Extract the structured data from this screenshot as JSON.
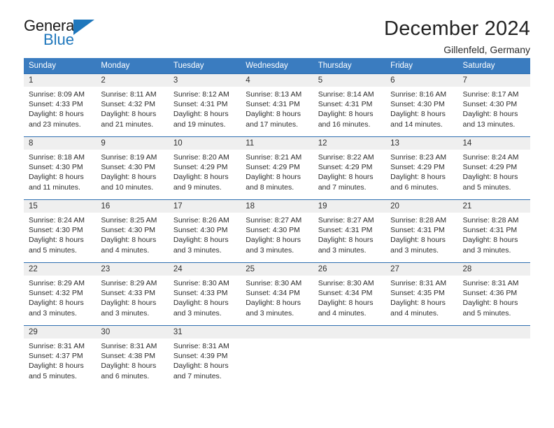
{
  "logo": {
    "name": "general-blue-logo",
    "text_top": "General",
    "text_bottom": "Blue",
    "accent_color": "#1f77bc"
  },
  "header": {
    "title": "December 2024",
    "location": "Gillenfeld, Germany"
  },
  "theme": {
    "header_row_bg": "#3a7cc0",
    "daynum_bg": "#efefef",
    "row_divider": "#2f6fb0",
    "text_color": "#2c2c2c"
  },
  "weekday_headers": [
    "Sunday",
    "Monday",
    "Tuesday",
    "Wednesday",
    "Thursday",
    "Friday",
    "Saturday"
  ],
  "weeks": [
    [
      {
        "day": "1",
        "sunrise": "Sunrise: 8:09 AM",
        "sunset": "Sunset: 4:33 PM",
        "daylight_line1": "Daylight: 8 hours",
        "daylight_line2": "and 23 minutes."
      },
      {
        "day": "2",
        "sunrise": "Sunrise: 8:11 AM",
        "sunset": "Sunset: 4:32 PM",
        "daylight_line1": "Daylight: 8 hours",
        "daylight_line2": "and 21 minutes."
      },
      {
        "day": "3",
        "sunrise": "Sunrise: 8:12 AM",
        "sunset": "Sunset: 4:31 PM",
        "daylight_line1": "Daylight: 8 hours",
        "daylight_line2": "and 19 minutes."
      },
      {
        "day": "4",
        "sunrise": "Sunrise: 8:13 AM",
        "sunset": "Sunset: 4:31 PM",
        "daylight_line1": "Daylight: 8 hours",
        "daylight_line2": "and 17 minutes."
      },
      {
        "day": "5",
        "sunrise": "Sunrise: 8:14 AM",
        "sunset": "Sunset: 4:31 PM",
        "daylight_line1": "Daylight: 8 hours",
        "daylight_line2": "and 16 minutes."
      },
      {
        "day": "6",
        "sunrise": "Sunrise: 8:16 AM",
        "sunset": "Sunset: 4:30 PM",
        "daylight_line1": "Daylight: 8 hours",
        "daylight_line2": "and 14 minutes."
      },
      {
        "day": "7",
        "sunrise": "Sunrise: 8:17 AM",
        "sunset": "Sunset: 4:30 PM",
        "daylight_line1": "Daylight: 8 hours",
        "daylight_line2": "and 13 minutes."
      }
    ],
    [
      {
        "day": "8",
        "sunrise": "Sunrise: 8:18 AM",
        "sunset": "Sunset: 4:30 PM",
        "daylight_line1": "Daylight: 8 hours",
        "daylight_line2": "and 11 minutes."
      },
      {
        "day": "9",
        "sunrise": "Sunrise: 8:19 AM",
        "sunset": "Sunset: 4:30 PM",
        "daylight_line1": "Daylight: 8 hours",
        "daylight_line2": "and 10 minutes."
      },
      {
        "day": "10",
        "sunrise": "Sunrise: 8:20 AM",
        "sunset": "Sunset: 4:29 PM",
        "daylight_line1": "Daylight: 8 hours",
        "daylight_line2": "and 9 minutes."
      },
      {
        "day": "11",
        "sunrise": "Sunrise: 8:21 AM",
        "sunset": "Sunset: 4:29 PM",
        "daylight_line1": "Daylight: 8 hours",
        "daylight_line2": "and 8 minutes."
      },
      {
        "day": "12",
        "sunrise": "Sunrise: 8:22 AM",
        "sunset": "Sunset: 4:29 PM",
        "daylight_line1": "Daylight: 8 hours",
        "daylight_line2": "and 7 minutes."
      },
      {
        "day": "13",
        "sunrise": "Sunrise: 8:23 AM",
        "sunset": "Sunset: 4:29 PM",
        "daylight_line1": "Daylight: 8 hours",
        "daylight_line2": "and 6 minutes."
      },
      {
        "day": "14",
        "sunrise": "Sunrise: 8:24 AM",
        "sunset": "Sunset: 4:29 PM",
        "daylight_line1": "Daylight: 8 hours",
        "daylight_line2": "and 5 minutes."
      }
    ],
    [
      {
        "day": "15",
        "sunrise": "Sunrise: 8:24 AM",
        "sunset": "Sunset: 4:30 PM",
        "daylight_line1": "Daylight: 8 hours",
        "daylight_line2": "and 5 minutes."
      },
      {
        "day": "16",
        "sunrise": "Sunrise: 8:25 AM",
        "sunset": "Sunset: 4:30 PM",
        "daylight_line1": "Daylight: 8 hours",
        "daylight_line2": "and 4 minutes."
      },
      {
        "day": "17",
        "sunrise": "Sunrise: 8:26 AM",
        "sunset": "Sunset: 4:30 PM",
        "daylight_line1": "Daylight: 8 hours",
        "daylight_line2": "and 3 minutes."
      },
      {
        "day": "18",
        "sunrise": "Sunrise: 8:27 AM",
        "sunset": "Sunset: 4:30 PM",
        "daylight_line1": "Daylight: 8 hours",
        "daylight_line2": "and 3 minutes."
      },
      {
        "day": "19",
        "sunrise": "Sunrise: 8:27 AM",
        "sunset": "Sunset: 4:31 PM",
        "daylight_line1": "Daylight: 8 hours",
        "daylight_line2": "and 3 minutes."
      },
      {
        "day": "20",
        "sunrise": "Sunrise: 8:28 AM",
        "sunset": "Sunset: 4:31 PM",
        "daylight_line1": "Daylight: 8 hours",
        "daylight_line2": "and 3 minutes."
      },
      {
        "day": "21",
        "sunrise": "Sunrise: 8:28 AM",
        "sunset": "Sunset: 4:31 PM",
        "daylight_line1": "Daylight: 8 hours",
        "daylight_line2": "and 3 minutes."
      }
    ],
    [
      {
        "day": "22",
        "sunrise": "Sunrise: 8:29 AM",
        "sunset": "Sunset: 4:32 PM",
        "daylight_line1": "Daylight: 8 hours",
        "daylight_line2": "and 3 minutes."
      },
      {
        "day": "23",
        "sunrise": "Sunrise: 8:29 AM",
        "sunset": "Sunset: 4:33 PM",
        "daylight_line1": "Daylight: 8 hours",
        "daylight_line2": "and 3 minutes."
      },
      {
        "day": "24",
        "sunrise": "Sunrise: 8:30 AM",
        "sunset": "Sunset: 4:33 PM",
        "daylight_line1": "Daylight: 8 hours",
        "daylight_line2": "and 3 minutes."
      },
      {
        "day": "25",
        "sunrise": "Sunrise: 8:30 AM",
        "sunset": "Sunset: 4:34 PM",
        "daylight_line1": "Daylight: 8 hours",
        "daylight_line2": "and 3 minutes."
      },
      {
        "day": "26",
        "sunrise": "Sunrise: 8:30 AM",
        "sunset": "Sunset: 4:34 PM",
        "daylight_line1": "Daylight: 8 hours",
        "daylight_line2": "and 4 minutes."
      },
      {
        "day": "27",
        "sunrise": "Sunrise: 8:31 AM",
        "sunset": "Sunset: 4:35 PM",
        "daylight_line1": "Daylight: 8 hours",
        "daylight_line2": "and 4 minutes."
      },
      {
        "day": "28",
        "sunrise": "Sunrise: 8:31 AM",
        "sunset": "Sunset: 4:36 PM",
        "daylight_line1": "Daylight: 8 hours",
        "daylight_line2": "and 5 minutes."
      }
    ],
    [
      {
        "day": "29",
        "sunrise": "Sunrise: 8:31 AM",
        "sunset": "Sunset: 4:37 PM",
        "daylight_line1": "Daylight: 8 hours",
        "daylight_line2": "and 5 minutes."
      },
      {
        "day": "30",
        "sunrise": "Sunrise: 8:31 AM",
        "sunset": "Sunset: 4:38 PM",
        "daylight_line1": "Daylight: 8 hours",
        "daylight_line2": "and 6 minutes."
      },
      {
        "day": "31",
        "sunrise": "Sunrise: 8:31 AM",
        "sunset": "Sunset: 4:39 PM",
        "daylight_line1": "Daylight: 8 hours",
        "daylight_line2": "and 7 minutes."
      },
      {
        "day": "",
        "sunrise": "",
        "sunset": "",
        "daylight_line1": "",
        "daylight_line2": ""
      },
      {
        "day": "",
        "sunrise": "",
        "sunset": "",
        "daylight_line1": "",
        "daylight_line2": ""
      },
      {
        "day": "",
        "sunrise": "",
        "sunset": "",
        "daylight_line1": "",
        "daylight_line2": ""
      },
      {
        "day": "",
        "sunrise": "",
        "sunset": "",
        "daylight_line1": "",
        "daylight_line2": ""
      }
    ]
  ]
}
